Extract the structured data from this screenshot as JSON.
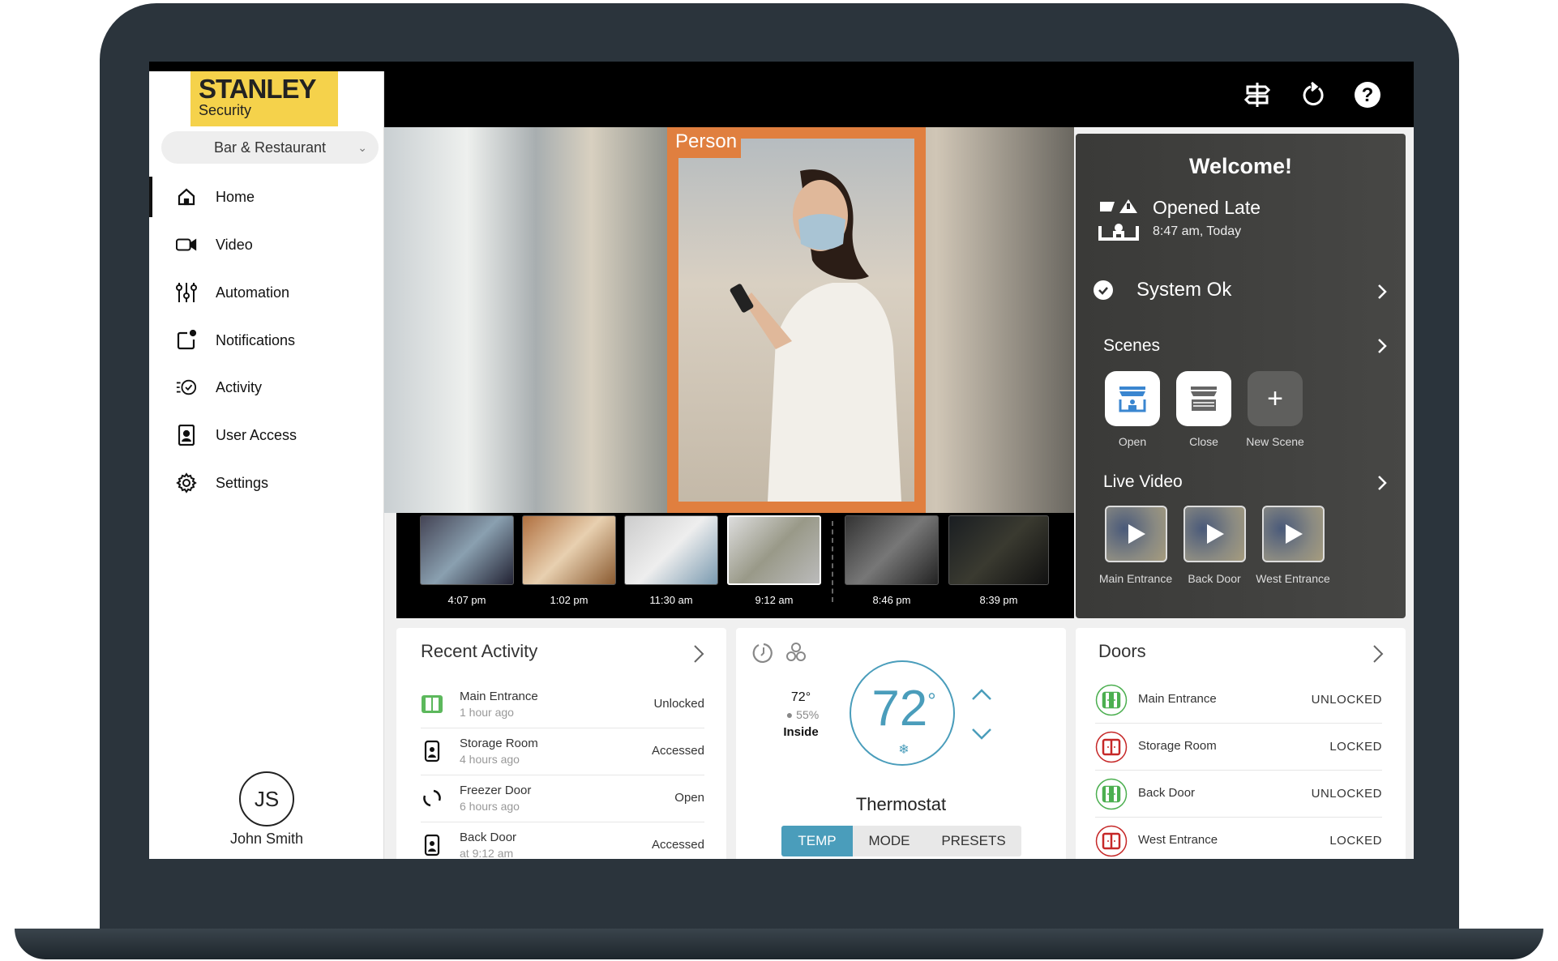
{
  "brand": {
    "name": "STANLEY",
    "sub": "Security",
    "accent": "#f5d24b"
  },
  "location_select": {
    "value": "Bar & Restaurant"
  },
  "nav": [
    {
      "label": "Home",
      "icon": "home-icon",
      "active": true
    },
    {
      "label": "Video",
      "icon": "video-camera-icon"
    },
    {
      "label": "Automation",
      "icon": "sliders-icon"
    },
    {
      "label": "Notifications",
      "icon": "notification-icon"
    },
    {
      "label": "Activity",
      "icon": "activity-icon"
    },
    {
      "label": "User Access",
      "icon": "badge-icon"
    },
    {
      "label": "Settings",
      "icon": "gear-icon"
    }
  ],
  "user": {
    "initials": "JS",
    "name": "John Smith"
  },
  "topbar": {
    "icons": [
      "signpost-icon",
      "refresh-icon",
      "help-icon"
    ]
  },
  "video": {
    "detection_label": "Person",
    "detection_color": "#e07f3f",
    "thumbnails": [
      {
        "time": "4:07 pm"
      },
      {
        "time": "1:02 pm"
      },
      {
        "time": "11:30 am"
      },
      {
        "time": "9:12 am"
      },
      {
        "time": "8:46 pm"
      },
      {
        "time": "8:39 pm"
      }
    ]
  },
  "welcome": {
    "title": "Welcome!",
    "alert_title": "Opened Late",
    "alert_time": "8:47 am, Today",
    "system_status": "System Ok",
    "scenes_label": "Scenes",
    "scenes": [
      {
        "label": "Open"
      },
      {
        "label": "Close"
      },
      {
        "label": "New Scene"
      }
    ],
    "live_video_label": "Live Video",
    "live_videos": [
      {
        "label": "Main Entrance"
      },
      {
        "label": "Back Door"
      },
      {
        "label": "West Entrance"
      }
    ]
  },
  "recent_activity": {
    "title": "Recent Activity",
    "items": [
      {
        "name": "Main Entrance",
        "time": "1 hour ago",
        "status": "Unlocked",
        "icon": "door-icon"
      },
      {
        "name": "Storage Room",
        "time": "4 hours ago",
        "status": "Accessed",
        "icon": "badge-icon"
      },
      {
        "name": "Freezer Door",
        "time": "6 hours ago",
        "status": "Open",
        "icon": "open-sensor-icon"
      },
      {
        "name": "Back Door",
        "time": "at 9:12 am",
        "status": "Accessed",
        "icon": "badge-icon"
      }
    ]
  },
  "thermostat": {
    "title": "Thermostat",
    "inside_temp": "72°",
    "humidity": "55%",
    "inside_label": "Inside",
    "setpoint": "72",
    "degree": "°",
    "tabs": [
      "TEMP",
      "MODE",
      "PRESETS"
    ],
    "active_tab": "TEMP",
    "accent": "#4a9dbb"
  },
  "doors": {
    "title": "Doors",
    "items": [
      {
        "name": "Main Entrance",
        "status": "UNLOCKED",
        "color": "#4caf50"
      },
      {
        "name": "Storage Room",
        "status": "LOCKED",
        "color": "#c62828"
      },
      {
        "name": "Back Door",
        "status": "UNLOCKED",
        "color": "#4caf50"
      },
      {
        "name": "West Entrance",
        "status": "LOCKED",
        "color": "#c62828"
      }
    ]
  }
}
